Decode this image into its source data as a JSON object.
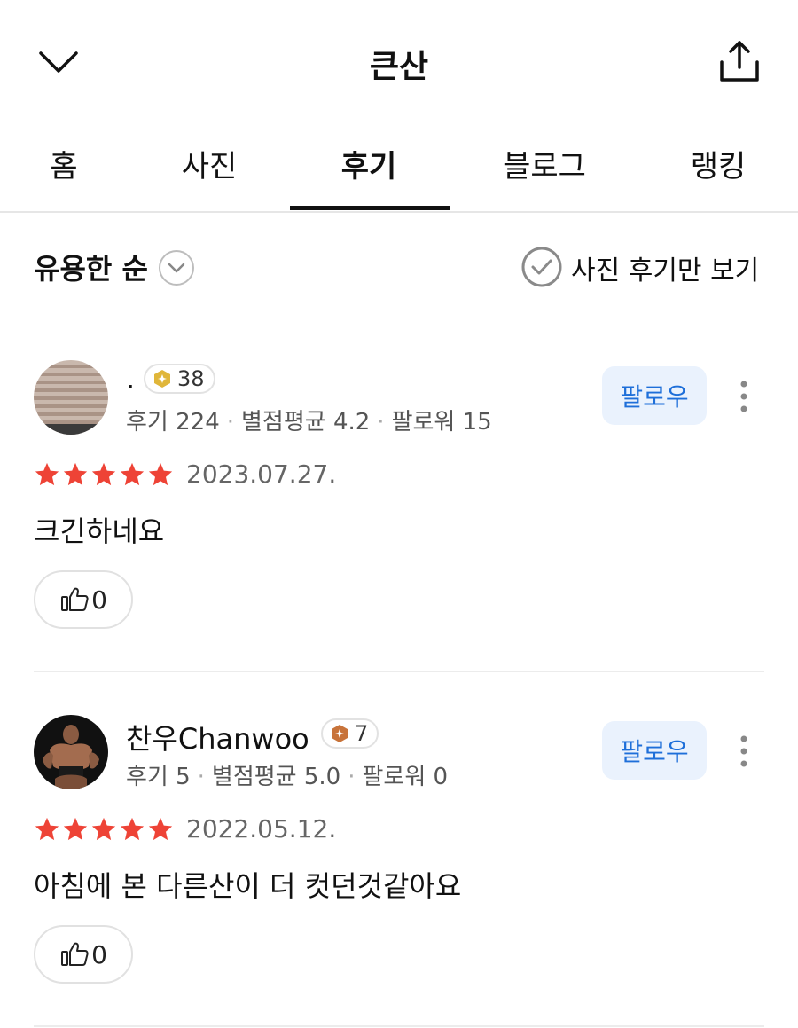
{
  "header": {
    "title": "큰산",
    "back_icon": "chevron-down-icon",
    "share_icon": "share-icon"
  },
  "tabs": [
    {
      "label": "홈",
      "active": false
    },
    {
      "label": "사진",
      "active": false
    },
    {
      "label": "후기",
      "active": true
    },
    {
      "label": "블로그",
      "active": false
    },
    {
      "label": "랭킹",
      "active": false
    }
  ],
  "filter": {
    "sort_label": "유용한 순",
    "photo_only_label": "사진 후기만 보기"
  },
  "reviews": [
    {
      "user_name": ".",
      "level": "38",
      "review_count": "후기 224",
      "avg_rating": "별점평균 4.2",
      "followers": "팔로워 15",
      "follow_label": "팔로우",
      "rating": 5,
      "date": "2023.07.27.",
      "text": "크긴하네요",
      "likes": "0"
    },
    {
      "user_name": "찬우Chanwoo",
      "level": "7",
      "review_count": "후기 5",
      "avg_rating": "별점평균 5.0",
      "followers": "팔로워 0",
      "follow_label": "팔로우",
      "rating": 5,
      "date": "2022.05.12.",
      "text": "아침에 본 다른산이 더 컷던것같아요",
      "likes": "0"
    }
  ],
  "colors": {
    "star": "#ee4336",
    "follow_text": "#1e6fd9",
    "follow_bg": "#eaf2fd",
    "badge_gold": "#e0b63a",
    "badge_bronze": "#c8733a"
  }
}
